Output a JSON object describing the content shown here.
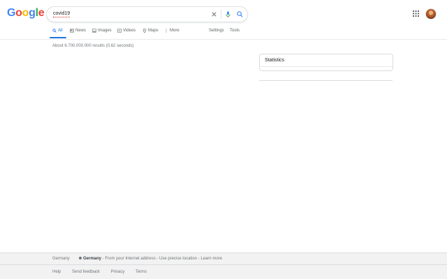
{
  "logo": {
    "letters": [
      "G",
      "o",
      "o",
      "g",
      "l",
      "e"
    ],
    "colors": [
      "#4285f4",
      "#ea4335",
      "#fbbc05",
      "#4285f4",
      "#34a853",
      "#ea4335"
    ]
  },
  "search": {
    "query": "covid19",
    "icons": [
      "close-icon",
      "mic-icon",
      "search-icon"
    ]
  },
  "header_icons": [
    "apps-grid-icon",
    "avatar"
  ],
  "tabs": [
    {
      "label": "All",
      "icon": "search-icon",
      "active": true
    },
    {
      "label": "News",
      "icon": "newspaper-icon"
    },
    {
      "label": "Images",
      "icon": "image-icon"
    },
    {
      "label": "Videos",
      "icon": "video-icon"
    },
    {
      "label": "Maps",
      "icon": "map-pin-icon"
    },
    {
      "label": "More",
      "icon": "more-vert-icon"
    }
  ],
  "tools": {
    "settings": "Settings",
    "tools": "Tools"
  },
  "result_stats": "About 6.700.000.000 results (0,62 seconds)",
  "side_panel": {
    "title": "Statistics"
  },
  "footer": {
    "country": "Germany",
    "location_place": "Germany",
    "location_source": "- From your Internet address - Use precise location - Learn more",
    "links": [
      "Help",
      "Send feedback",
      "Privacy",
      "Terms"
    ]
  },
  "colors": {
    "accent": "#1a73e8",
    "footer_bg": "#f2f2f2"
  }
}
